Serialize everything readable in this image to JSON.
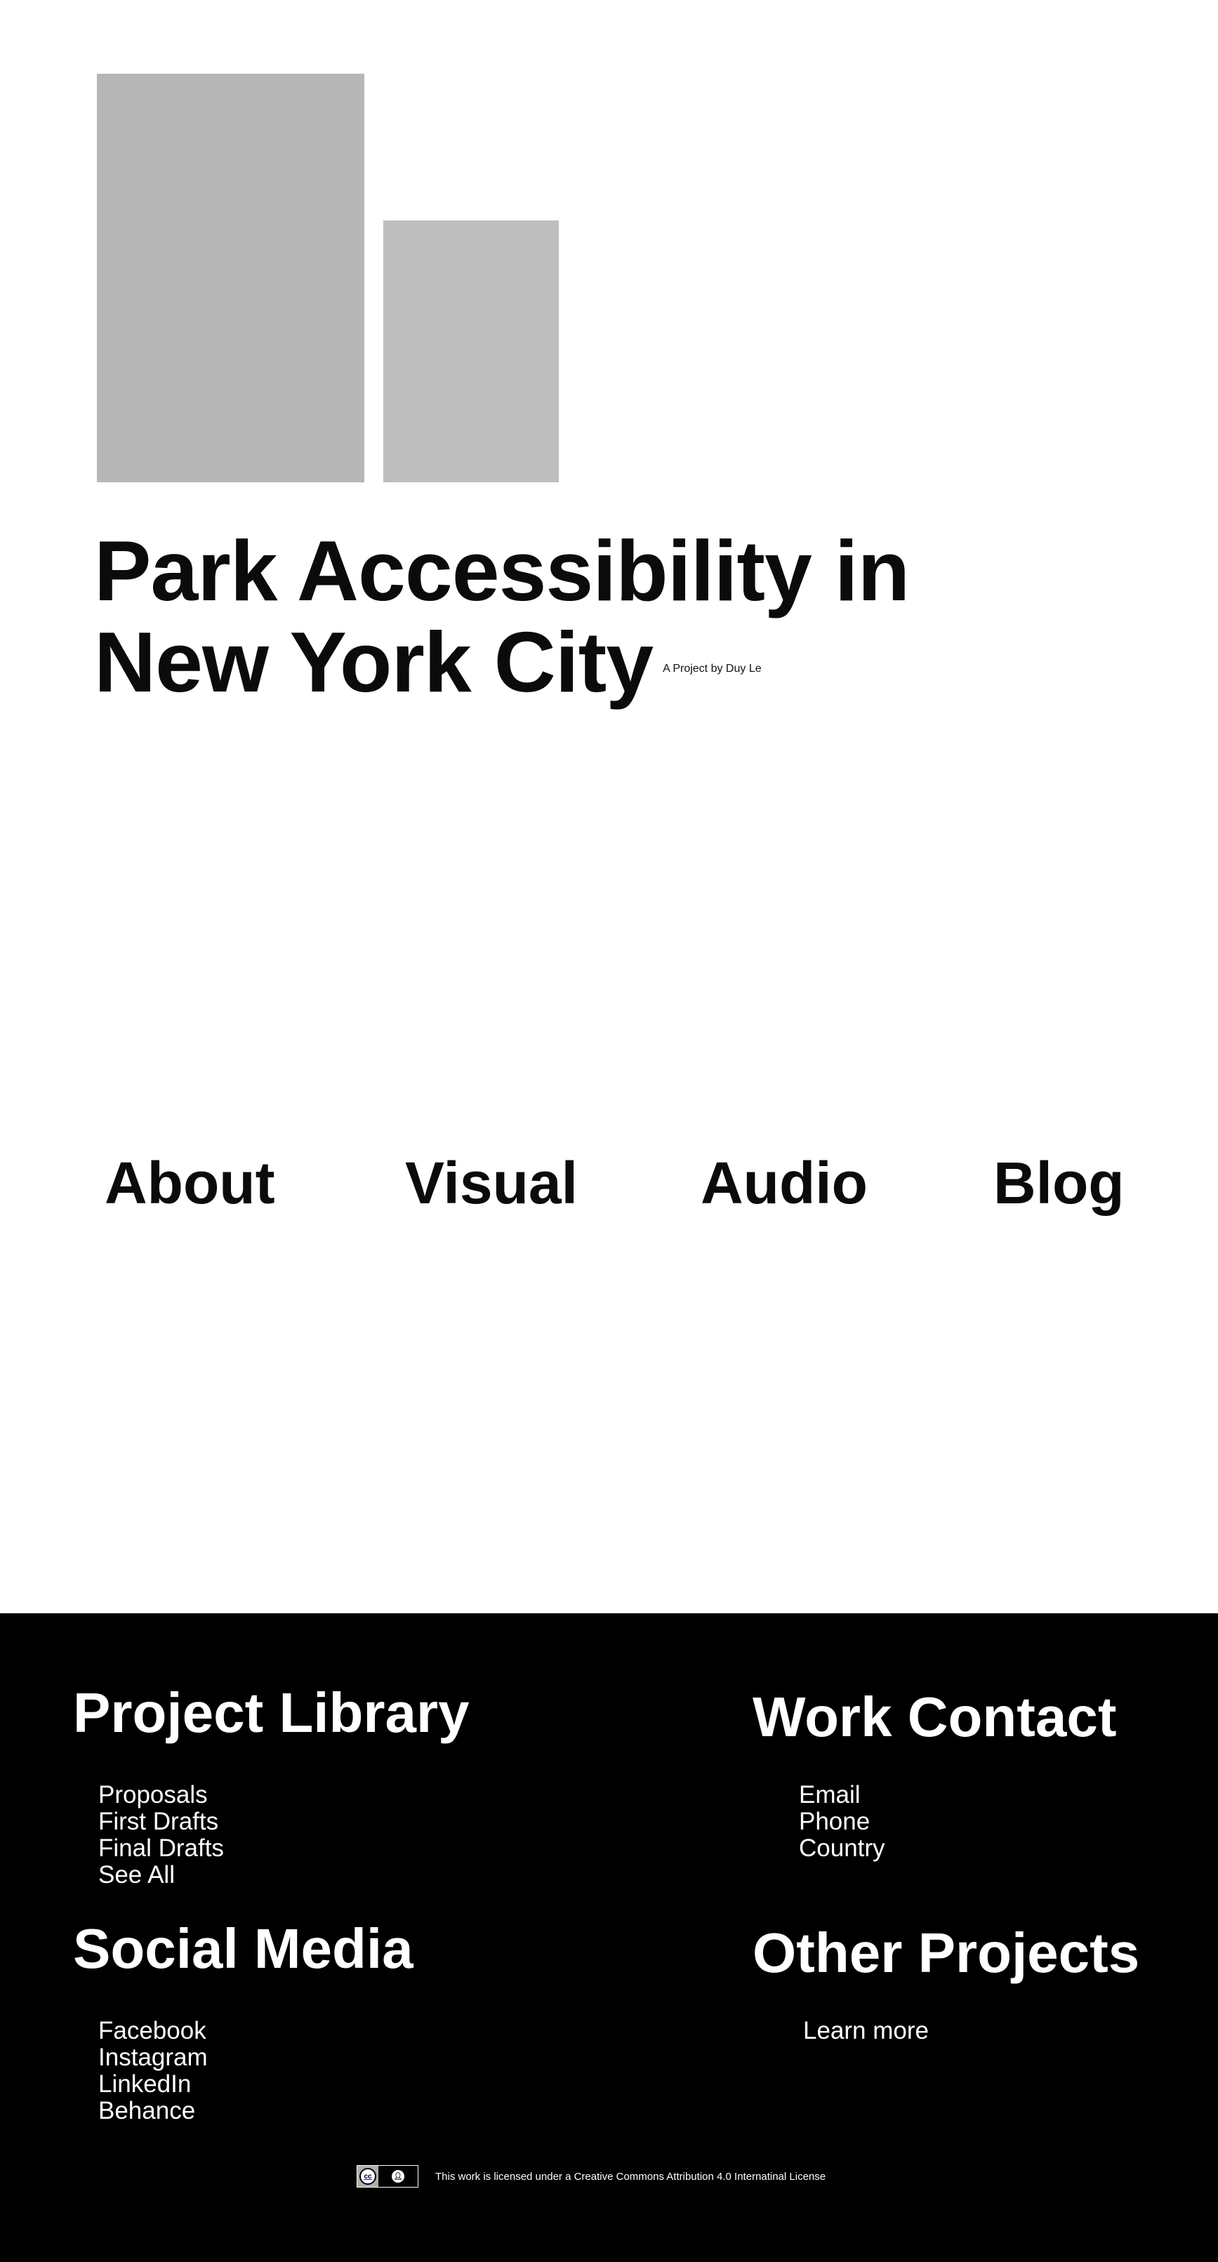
{
  "header": {
    "title_line1": "Park Accessibility in",
    "title_line2": "New York City",
    "byline": "A Project by Duy Le"
  },
  "nav": {
    "about": "About",
    "visual": "Visual",
    "audio": "Audio",
    "blog": "Blog"
  },
  "footer": {
    "project_library": {
      "heading": "Project Library",
      "items": [
        "Proposals",
        "First Drafts",
        "Final Drafts",
        "See All"
      ]
    },
    "social_media": {
      "heading": "Social Media",
      "items": [
        "Facebook",
        "Instagram",
        "LinkedIn",
        "Behance"
      ]
    },
    "work_contact": {
      "heading": "Work Contact",
      "items": [
        "Email",
        "Phone",
        "Country"
      ]
    },
    "other_projects": {
      "heading": "Other Projects",
      "items": [
        "Learn more"
      ]
    },
    "license": {
      "badge_icon": "creative-commons-by-icon",
      "text": "This work is licensed under a Creative Commons Attribution 4.0 Internatinal License"
    }
  },
  "colors": {
    "background": "#ffffff",
    "footer_background": "#000000",
    "placeholder_large": "#b7b7b7",
    "placeholder_small": "#bebebe",
    "text": "#0b0b0b"
  }
}
